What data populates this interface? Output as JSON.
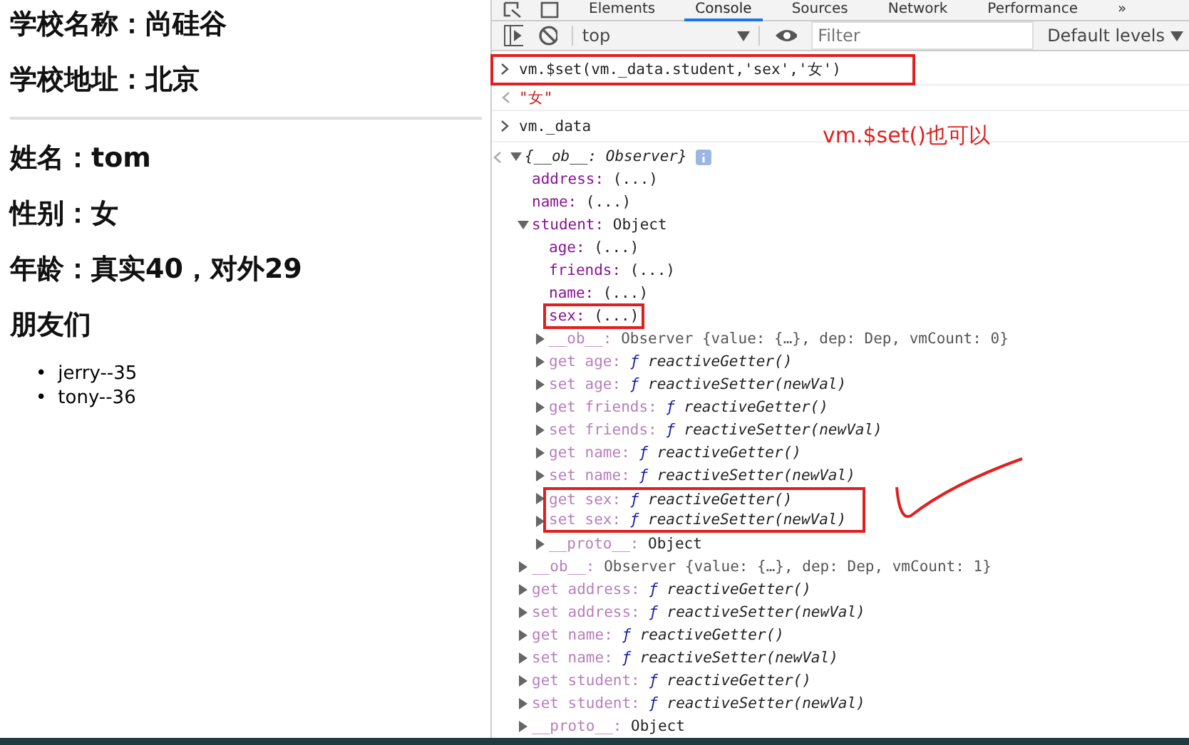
{
  "page": {
    "school_headings": [
      "学校名称：尚硅谷",
      "学校地址：北京"
    ],
    "student_headings": [
      "姓名：tom",
      "性别：女",
      "年龄：真实40，对外29",
      "朋友们"
    ],
    "friends": [
      {
        "bullet": "•",
        "text": "jerry--35"
      },
      {
        "bullet": "•",
        "text": "tony--36"
      }
    ]
  },
  "devtools": {
    "tabs": [
      {
        "label": "Elements",
        "selected": false
      },
      {
        "label": "Console",
        "selected": true
      },
      {
        "label": "Sources",
        "selected": false
      },
      {
        "label": "Network",
        "selected": false
      },
      {
        "label": "Performance",
        "selected": false
      }
    ],
    "more": "»",
    "context": "top",
    "filter": {
      "placeholder": "Filter"
    },
    "levels": "Default levels"
  },
  "console": [
    {
      "kind": "input",
      "text": "vm.$set(vm._data.student,'sex','女')",
      "highlighted": true
    },
    {
      "kind": "result",
      "text": "\"女\""
    },
    {
      "kind": "input",
      "text": "vm._data",
      "highlighted": false
    },
    {
      "kind": "tree",
      "root": {
        "kind": "root",
        "key": "{__ob__: Observer}",
        "expanded": true,
        "children": [
          {
            "kind": "prop",
            "key": "address:",
            "value": "(...)"
          },
          {
            "kind": "prop",
            "key": "name:",
            "value": "(...)"
          },
          {
            "kind": "object",
            "key": "student:",
            "value": "Object",
            "expanded": true,
            "children": [
              {
                "kind": "prop",
                "key": "age:",
                "value": "(...)"
              },
              {
                "kind": "prop",
                "key": "friends:",
                "value": "(...)"
              },
              {
                "kind": "prop",
                "key": "name:",
                "value": "(...)"
              },
              {
                "kind": "prop",
                "key": "sex:",
                "value": "(...)",
                "highlighted": true
              },
              {
                "kind": "internal",
                "key": "__ob__:",
                "value": "Observer {value: {…}, dep: Dep, vmCount: 0}",
                "expanded": false
              },
              {
                "kind": "accessor",
                "key": "get age:",
                "fn": "ƒ",
                "value": "reactiveGetter()",
                "expanded": false
              },
              {
                "kind": "accessor",
                "key": "set age:",
                "fn": "ƒ",
                "value": "reactiveSetter(newVal)",
                "expanded": false
              },
              {
                "kind": "accessor",
                "key": "get friends:",
                "fn": "ƒ",
                "value": "reactiveGetter()",
                "expanded": false
              },
              {
                "kind": "accessor",
                "key": "set friends:",
                "fn": "ƒ",
                "value": "reactiveSetter(newVal)",
                "expanded": false
              },
              {
                "kind": "accessor",
                "key": "get name:",
                "fn": "ƒ",
                "value": "reactiveGetter()",
                "expanded": false
              },
              {
                "kind": "accessor",
                "key": "set name:",
                "fn": "ƒ",
                "value": "reactiveSetter(newVal)",
                "expanded": false
              },
              {
                "kind": "accessor",
                "key": "get sex:",
                "fn": "ƒ",
                "value": "reactiveGetter()",
                "expanded": false,
                "highlighted": true
              },
              {
                "kind": "accessor",
                "key": "set sex:",
                "fn": "ƒ",
                "value": "reactiveSetter(newVal)",
                "expanded": false,
                "highlighted": true
              },
              {
                "kind": "proto",
                "key": "__proto__:",
                "value": "Object",
                "expanded": false
              }
            ]
          },
          {
            "kind": "internal",
            "key": "__ob__:",
            "value": "Observer {value: {…}, dep: Dep, vmCount: 1}",
            "expanded": false
          },
          {
            "kind": "accessor",
            "key": "get address:",
            "fn": "ƒ",
            "value": "reactiveGetter()",
            "expanded": false
          },
          {
            "kind": "accessor",
            "key": "set address:",
            "fn": "ƒ",
            "value": "reactiveSetter(newVal)",
            "expanded": false
          },
          {
            "kind": "accessor",
            "key": "get name:",
            "fn": "ƒ",
            "value": "reactiveGetter()",
            "expanded": false
          },
          {
            "kind": "accessor",
            "key": "set name:",
            "fn": "ƒ",
            "value": "reactiveSetter(newVal)",
            "expanded": false
          },
          {
            "kind": "accessor",
            "key": "get student:",
            "fn": "ƒ",
            "value": "reactiveGetter()",
            "expanded": false
          },
          {
            "kind": "accessor",
            "key": "set student:",
            "fn": "ƒ",
            "value": "reactiveSetter(newVal)",
            "expanded": false
          },
          {
            "kind": "proto",
            "key": "__proto__:",
            "value": "Object",
            "expanded": false
          }
        ]
      }
    }
  ],
  "annotation": {
    "note": "vm.$set()也可以"
  }
}
